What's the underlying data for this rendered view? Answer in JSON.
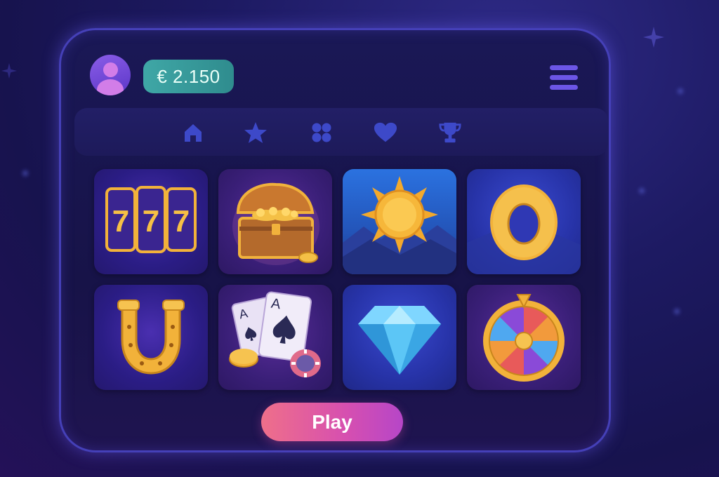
{
  "header": {
    "balance": "€ 2.150",
    "avatar_icon": "user-icon",
    "menu_icon": "hamburger-menu-icon"
  },
  "nav": {
    "items": [
      {
        "id": "home",
        "icon": "home-icon"
      },
      {
        "id": "favorites",
        "icon": "star-icon"
      },
      {
        "id": "games",
        "icon": "grid-icon"
      },
      {
        "id": "liked",
        "icon": "heart-icon"
      },
      {
        "id": "trophy",
        "icon": "trophy-icon"
      }
    ],
    "icon_color": "#3d49c9"
  },
  "games": [
    {
      "id": "sevens",
      "icon": "triple-seven-slot-icon",
      "text": "777"
    },
    {
      "id": "treasure",
      "icon": "treasure-chest-icon"
    },
    {
      "id": "sun",
      "icon": "sun-icon"
    },
    {
      "id": "ring",
      "icon": "gold-ring-icon"
    },
    {
      "id": "horseshoe",
      "icon": "horseshoe-icon"
    },
    {
      "id": "cards",
      "icon": "playing-cards-icon",
      "card_rank": "A"
    },
    {
      "id": "diamond",
      "icon": "diamond-icon"
    },
    {
      "id": "wheel",
      "icon": "fortune-wheel-icon"
    }
  ],
  "actions": {
    "play_label": "Play"
  },
  "colors": {
    "accent_gold": "#f2b23a",
    "balance_bg": "#3fa7a6",
    "play_gradient_start": "#ef6f8a",
    "play_gradient_end": "#b646c8"
  }
}
